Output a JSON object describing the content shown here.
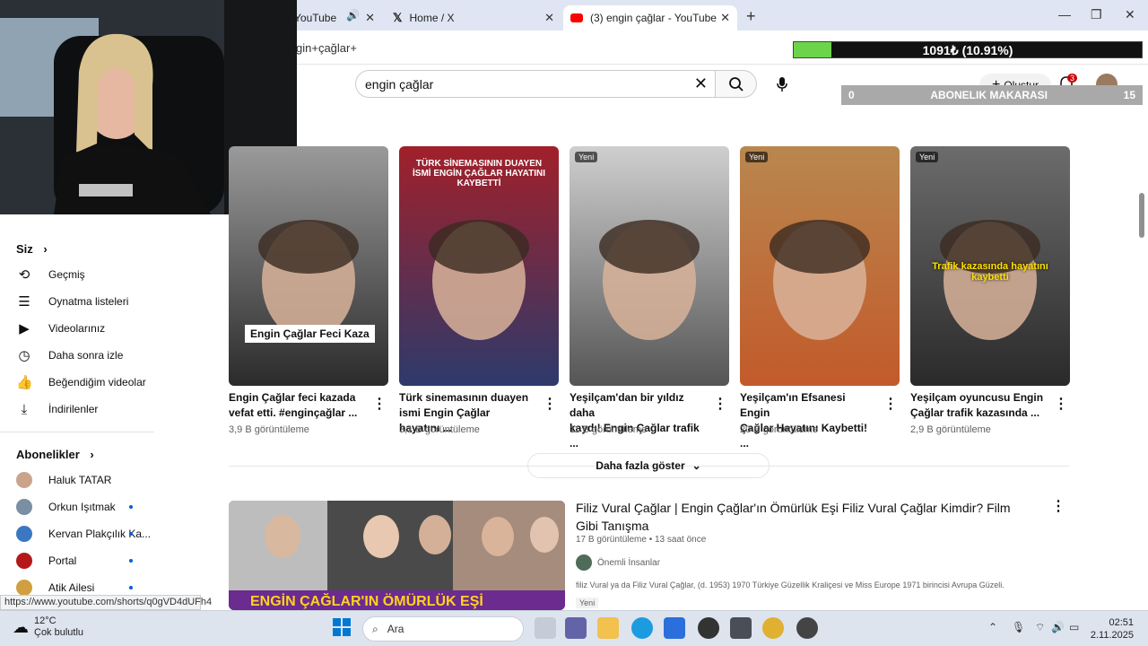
{
  "browser": {
    "tabs": [
      {
        "label": "YouTube"
      },
      {
        "label": "Home / X"
      },
      {
        "label": "(3) engin çağlar - YouTube"
      }
    ],
    "address": "gin+çağlar+"
  },
  "overlay": {
    "progress_text": "1091₺ (10.91%)",
    "progress_fraction": 0.1091,
    "reel_label": "ABONELIK MAKARASI",
    "reel_left": "0",
    "reel_right": "15"
  },
  "youtube": {
    "search_value": "engin çağlar",
    "create_label": "Oluştur",
    "notif_count": "3"
  },
  "sidebar": {
    "you_label": "Siz",
    "items": [
      {
        "label": "Geçmiş",
        "icon": "history-icon"
      },
      {
        "label": "Oynatma listeleri",
        "icon": "playlist-icon"
      },
      {
        "label": "Videolarınız",
        "icon": "your-videos-icon"
      },
      {
        "label": "Daha sonra izle",
        "icon": "watch-later-icon"
      },
      {
        "label": "Beğendiğim videolar",
        "icon": "like-icon"
      },
      {
        "label": "İndirilenler",
        "icon": "download-icon"
      }
    ],
    "subs_label": "Abonelikler",
    "subs": [
      {
        "label": "Haluk TATAR",
        "color": "#c9a48b",
        "dot": false
      },
      {
        "label": "Orkun Işıtmak",
        "color": "#7a8fa3",
        "dot": true
      },
      {
        "label": "Kervan Plakçılık Ka...",
        "color": "#3b78c2",
        "dot": true
      },
      {
        "label": "Portal",
        "color": "#b51818",
        "dot": true
      },
      {
        "label": "Atik Ailesi",
        "color": "#d0a040",
        "dot": true
      }
    ]
  },
  "status_url": "https://www.youtube.com/shorts/q0gVD4dUFh4",
  "shorts": [
    {
      "title1": "Engin Çağlar feci kazada",
      "title2": "vefat etti. #enginçağlar ...",
      "views": "3,9 B görüntüleme",
      "thumb_caption": "Engin Çağlar Feci Kaza",
      "badge": ""
    },
    {
      "title1": "Türk sinemasının duayen",
      "title2": "ismi Engin Çağlar hayatını ...",
      "views": "3,1 B görüntüleme",
      "thumb_caption": "TÜRK SİNEMASININ DUAYEN İSMİ ENGİN ÇAĞLAR HAYATINI KAYBETTİ",
      "badge": ""
    },
    {
      "title1": "Yeşilçam'dan bir yıldız daha",
      "title2": "kaydı! Engin Çağlar trafik ...",
      "views": "11 B görüntüleme",
      "thumb_caption": "",
      "badge": "Yeni"
    },
    {
      "title1": "Yeşilçam'ın Efsanesi Engin",
      "title2": "Çağlar Hayatını Kaybetti! ...",
      "views": "20 B görüntüleme",
      "thumb_caption": "",
      "badge": "Yeni"
    },
    {
      "title1": "Yeşilçam oyuncusu Engin",
      "title2": "Çağlar trafik kazasında ...",
      "views": "2,9 B görüntüleme",
      "thumb_caption": "Trafik kazasında hayatını kaybetti",
      "badge": "Yeni"
    }
  ],
  "more_label": "Daha fazla göster",
  "video": {
    "title": "Filiz Vural Çağlar | Engin Çağlar'ın Ömürlük Eşi Filiz Vural Çağlar Kimdir? Film Gibi Tanışma",
    "meta": "17 B görüntüleme • 13 saat önce",
    "channel": "Önemli İnsanlar",
    "desc": "filiz Vural ya da Filiz Vural Çağlar, (d. 1953) 1970 Türkiye Güzellik Kraliçesi ve Miss Europe 1971 birincisi Avrupa Güzeli.",
    "badge": "Yeni",
    "thumb_caption": "ENGİN ÇAĞLAR'IN ÖMÜRLÜK EŞİ"
  },
  "taskbar": {
    "temp": "12°C",
    "weather": "Çok bulutlu",
    "search_placeholder": "Ara",
    "time": "02:51",
    "date": "2.11.2025"
  }
}
